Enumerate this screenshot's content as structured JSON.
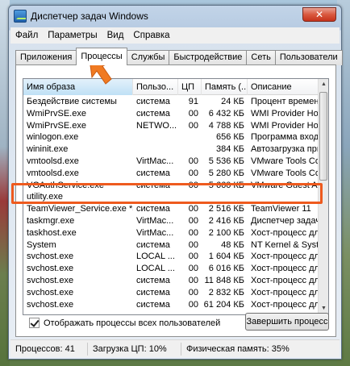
{
  "window": {
    "title": "Диспетчер задач Windows",
    "close": "✕"
  },
  "menu": [
    "Файл",
    "Параметры",
    "Вид",
    "Справка"
  ],
  "tabs": [
    "Приложения",
    "Процессы",
    "Службы",
    "Быстродействие",
    "Сеть",
    "Пользователи"
  ],
  "active_tab": "Процессы",
  "table": {
    "columns": [
      "Имя образа",
      "Пользо...",
      "ЦП",
      "Память (...",
      "Описание"
    ],
    "rows": [
      [
        "Бездействие системы",
        "система",
        "91",
        "24 КБ",
        "Процент времени"
      ],
      [
        "WmiPrvSE.exe",
        "система",
        "00",
        "6 432 КБ",
        "WMI Provider Host"
      ],
      [
        "WmiPrvSE.exe",
        "NETWO...",
        "00",
        "4 788 КБ",
        "WMI Provider Host"
      ],
      [
        "winlogon.exe",
        "",
        "",
        "656 КБ",
        "Программа входа"
      ],
      [
        "wininit.exe",
        "",
        "",
        "384 КБ",
        "Автозагрузка прил"
      ],
      [
        "vmtoolsd.exe",
        "VirtMac...",
        "00",
        "5 536 КБ",
        "VMware Tools Core"
      ],
      [
        "vmtoolsd.exe",
        "система",
        "00",
        "5 280 КБ",
        "VMware Tools Core"
      ],
      [
        "VGAuthService.exe",
        "система",
        "00",
        "5 660 КБ",
        "VMware Guest Auth"
      ],
      [
        "utility.exe",
        "",
        "",
        "",
        ""
      ],
      [
        "TeamViewer_Service.exe *32",
        "система",
        "00",
        "2 516 КБ",
        "TeamViewer 11"
      ],
      [
        "taskmgr.exe",
        "VirtMac...",
        "00",
        "2 416 КБ",
        "Диспетчер задач"
      ],
      [
        "taskhost.exe",
        "VirtMac...",
        "00",
        "2 100 КБ",
        "Хост-процесс для"
      ],
      [
        "System",
        "система",
        "00",
        "48 КБ",
        "NT Kernel & System"
      ],
      [
        "svchost.exe",
        "LOCAL ...",
        "00",
        "1 604 КБ",
        "Хост-процесс для"
      ],
      [
        "svchost.exe",
        "LOCAL ...",
        "00",
        "6 016 КБ",
        "Хост-процесс для"
      ],
      [
        "svchost.exe",
        "система",
        "00",
        "11 848 КБ",
        "Хост-процесс для"
      ],
      [
        "svchost.exe",
        "система",
        "00",
        "2 832 КБ",
        "Хост-процесс для"
      ],
      [
        "svchost.exe",
        "система",
        "00",
        "61 204 КБ",
        "Хост-процесс для"
      ]
    ]
  },
  "show_all_users": {
    "label": "Отображать процессы всех пользователей",
    "checked": true
  },
  "end_process_label": "Завершить процесс",
  "status": {
    "processes": "Процессов: 41",
    "cpu": "Загрузка ЦП: 10%",
    "memory": "Физическая память: 35%"
  },
  "colors": {
    "highlight": "#ee5a1e",
    "arrow": "#f07a22"
  }
}
